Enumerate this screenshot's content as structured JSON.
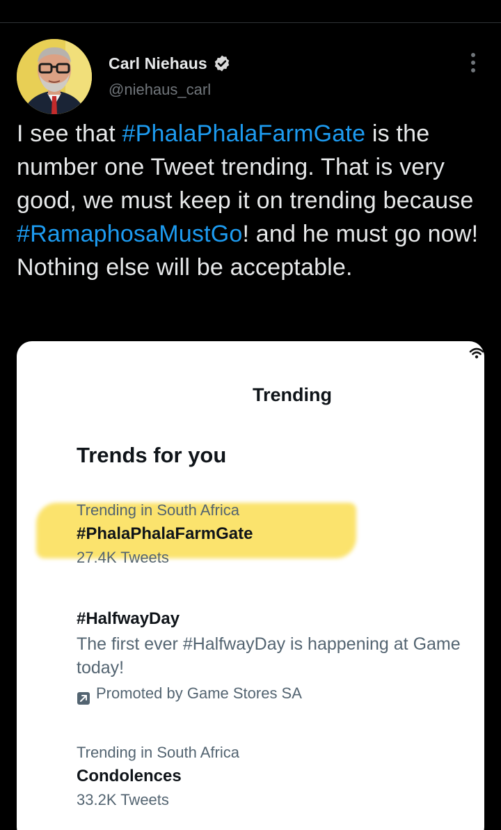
{
  "tweet": {
    "author": {
      "display_name": "Carl Niehaus",
      "handle": "@niehaus_carl",
      "verified": true,
      "avatar_icon": "profile-photo"
    },
    "more_icon": "more-options-icon",
    "text": {
      "part1": "I see that ",
      "hashtag1": "#PhalaPhalaFarmGate",
      "part2": " is the number one Tweet trending. That is very good, we must keep it on trending because ",
      "hashtag2": "#RamaphosaMustGo",
      "part3": "! and he must go now! Nothing else will be acceptable."
    },
    "link_color": "#1d9bf0"
  },
  "media": {
    "header_title": "Trending",
    "section_title": "Trends for you",
    "highlight_color": "#fada3c",
    "trends": [
      {
        "context": "Trending in South Africa",
        "name": "#PhalaPhalaFarmGate",
        "count": "27.4K Tweets",
        "highlighted": true
      },
      {
        "name": "#HalfwayDay",
        "description": "The first ever #HalfwayDay is happening at Game today!",
        "promoted": "Promoted by Game Stores SA",
        "promoted_icon": "promoted-arrow-icon"
      },
      {
        "context": "Trending in South Africa",
        "name": "Condolences",
        "count": "33.2K Tweets"
      }
    ]
  }
}
